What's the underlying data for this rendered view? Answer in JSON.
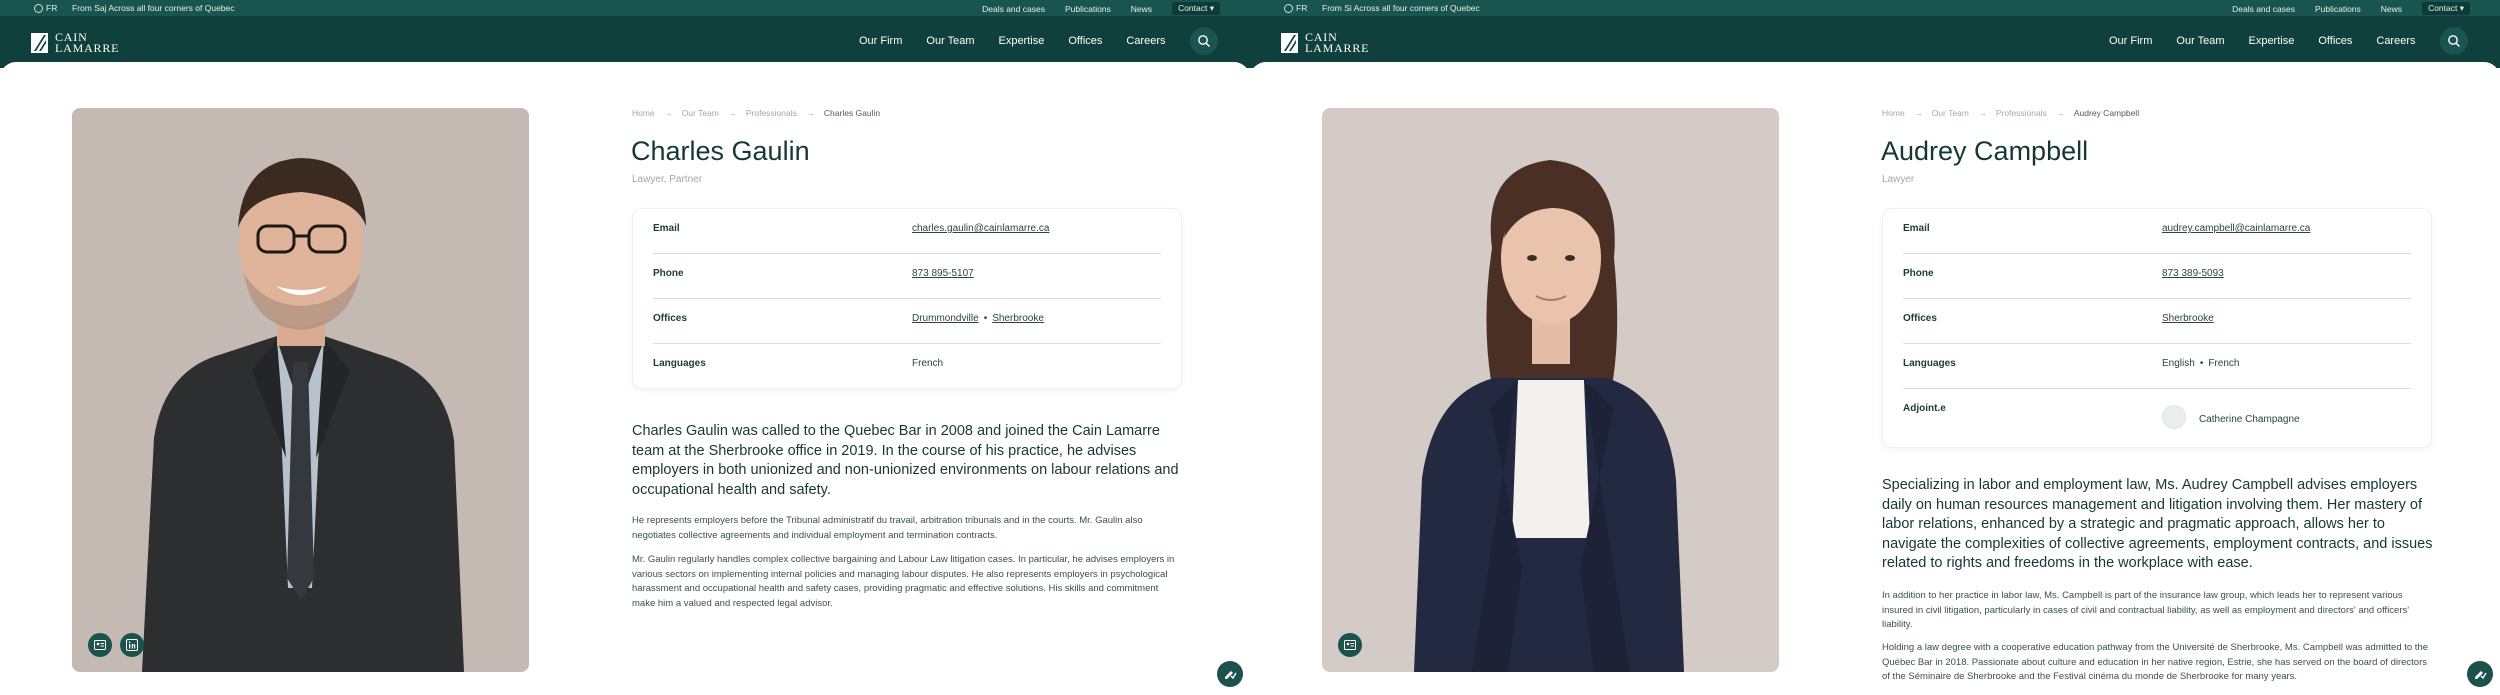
{
  "colors": {
    "brand_dark": "#0f403c",
    "topbar": "#18554f",
    "accent": "#1c524c"
  },
  "topbar": {
    "lang": "FR",
    "tagline": "From Saj Across all four corners of Quebec",
    "links": [
      "Deals and cases",
      "Publications",
      "News"
    ],
    "contact": "Contact"
  },
  "logo": {
    "line1": "CAIN",
    "line2": "LAMARRE"
  },
  "nav": [
    "Our Firm",
    "Our Team",
    "Expertise",
    "Offices",
    "Careers"
  ],
  "icons": {
    "search": "search-icon",
    "globe": "globe-icon",
    "vcard": "vcard-icon",
    "linkedin": "linkedin-icon",
    "fab": "edit-check-icon"
  },
  "profiles": [
    {
      "topbar_tagline": "From Saj Across all four corners of Quebec",
      "breadcrumb": [
        "Home",
        "Our Team",
        "Professionals",
        "Charles Gaulin"
      ],
      "name": "Charles Gaulin",
      "role": "Lawyer, Partner",
      "labels": {
        "email": "Email",
        "phone": "Phone",
        "offices": "Offices",
        "languages": "Languages"
      },
      "email": "charles.gaulin@cainlamarre.ca",
      "phone": "873 895-5107",
      "offices": [
        "Drummondville",
        "Sherbrooke"
      ],
      "languages": [
        "French"
      ],
      "lead": "Charles Gaulin was called to the Quebec Bar in 2008 and joined the Cain Lamarre team at the Sherbrooke office in 2019. In the course of his practice, he advises employers in both unionized and non-unionized environments on labour relations and occupational health and safety.",
      "paragraphs": [
        "He represents employers before the Tribunal administratif du travail, arbitration tribunals and in the courts. Mr. Gaulin also negotiates collective agreements and individual employment and termination contracts.",
        "Mr. Gaulin regularly handles complex collective bargaining and Labour Law litigation cases. In particular, he advises employers in various sectors on implementing internal policies and managing labour disputes. He also represents employers in psychological harassment and occupational health and safety cases, providing pragmatic and effective solutions. His skills and commitment make him a valued and respected legal advisor."
      ]
    },
    {
      "topbar_tagline": "From Si Across all four corners of Quebec",
      "breadcrumb": [
        "Home",
        "Our Team",
        "Professionals",
        "Audrey Campbell"
      ],
      "name": "Audrey Campbell",
      "role": "Lawyer",
      "labels": {
        "email": "Email",
        "phone": "Phone",
        "offices": "Offices",
        "languages": "Languages",
        "adjoint": "Adjoint.e"
      },
      "email": "audrey.campbell@cainlamarre.ca",
      "phone": "873 389-5093",
      "offices": [
        "Sherbrooke"
      ],
      "languages": [
        "English",
        "French"
      ],
      "adjoint": "Catherine Champagne",
      "lead": "Specializing in labor and employment law, Ms. Audrey Campbell advises employers daily on human resources management and litigation involving them. Her mastery of labor relations, enhanced by a strategic and pragmatic approach, allows her to navigate the complexities of collective agreements, employment contracts, and issues related to rights and freedoms in the workplace with ease.",
      "paragraphs": [
        "In addition to her practice in labor law, Ms. Campbell is part of the insurance law group, which leads her to represent various insured in civil litigation, particularly in cases of civil and contractual liability, as well as employment and directors' and officers' liability.",
        "Holding a law degree with a cooperative education pathway from the Université de Sherbrooke, Ms. Campbell was admitted to the Québec Bar in 2018. Passionate about culture and education in her native region, Estrie, she has served on the board of directors of the Séminaire de Sherbrooke and the Festival cinéma du monde de Sherbrooke for many years."
      ]
    }
  ]
}
